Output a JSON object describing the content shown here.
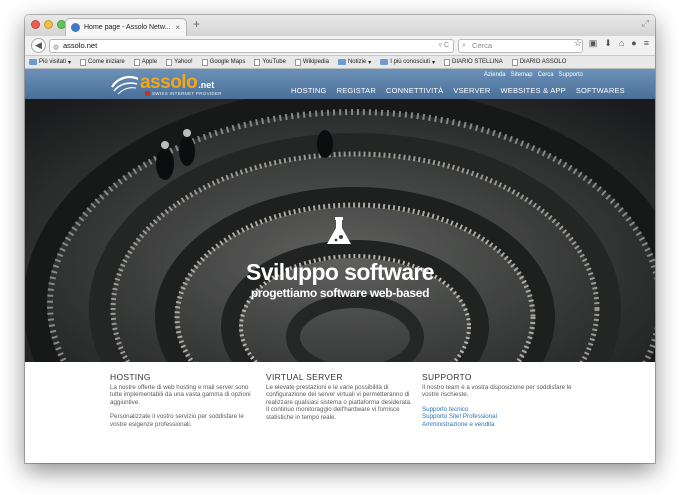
{
  "browser": {
    "tab_title": "Home page - Assolo Netw...",
    "url": "assolo.net",
    "search_placeholder": "Cerca",
    "bookmarks": [
      "Più visitati",
      "Come iniziare",
      "Apple",
      "Yahoo!",
      "Google Maps",
      "YouTube",
      "Wikipedia",
      "Notizie",
      "I più conosciuti",
      "DIARIO STELLINA",
      "DIARIO ASSOLO"
    ]
  },
  "site": {
    "logo_word": "assolo",
    "logo_suffix": ".net",
    "logo_tagline": "SWISS INTERNET PROVIDER",
    "utility_links": [
      "Azienda",
      "Sitemap",
      "Cerca",
      "Supporto"
    ],
    "nav": [
      "HOSTING",
      "REGISTAR",
      "CONNETTIVITÀ",
      "VSERVER",
      "WEBSITES & APP",
      "SOFTWARES"
    ],
    "hero_title": "Sviluppo software",
    "hero_subtitle": "progettiamo software web-based",
    "colors": {
      "brand_orange": "#f2a61c",
      "header_blue": "#4f759d",
      "link_blue": "#2e73b8"
    },
    "columns": {
      "hosting": {
        "title": "HOSTING",
        "p1": "La nostre offerte di web hosting e mail server sono tutte implementabili da una vasta gamma di opzioni aggiuntive.",
        "p2": "Personalizzate il vostro servizio per soddisfare le vostre esigenze professionali."
      },
      "vserver": {
        "title": "VIRTUAL SERVER",
        "p1": "Le elevate prestazioni e le varie possibilità di configurazione dei server virtuali vi permetteranno di realizzare qualsiasi sistema o piattaforma desiderata.",
        "p2": "Il continuo monitoraggio dell'hardware vi fornisce statistiche in tempo reale."
      },
      "support": {
        "title": "SUPPORTO",
        "p1": "Il nostro team è a vostra disposizione per soddisfare le vostre rischieste.",
        "links": [
          "Supporto tecnico",
          "Supporto Site! Professional",
          "Amministrazione e vendita"
        ]
      }
    }
  }
}
